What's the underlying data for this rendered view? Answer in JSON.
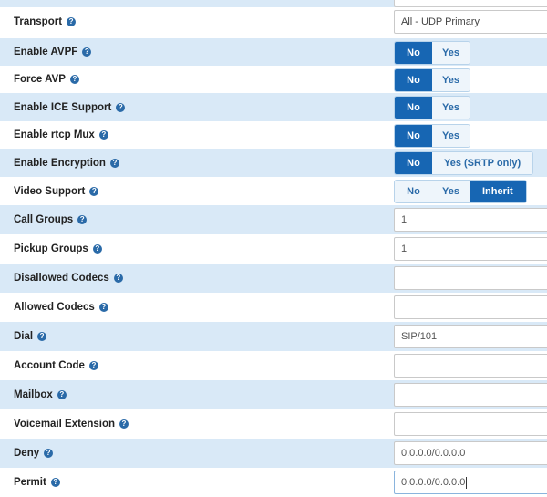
{
  "rows": [
    {
      "label": "Transport",
      "type": "select",
      "value": "All - UDP Primary"
    },
    {
      "label": "Enable AVPF",
      "type": "toggle",
      "options": [
        "No",
        "Yes"
      ],
      "selected": "No"
    },
    {
      "label": "Force AVP",
      "type": "toggle",
      "options": [
        "No",
        "Yes"
      ],
      "selected": "No"
    },
    {
      "label": "Enable ICE Support",
      "type": "toggle",
      "options": [
        "No",
        "Yes"
      ],
      "selected": "No"
    },
    {
      "label": "Enable rtcp Mux",
      "type": "toggle",
      "options": [
        "No",
        "Yes"
      ],
      "selected": "No"
    },
    {
      "label": "Enable Encryption",
      "type": "toggle",
      "options": [
        "No",
        "Yes (SRTP only)"
      ],
      "selected": "No"
    },
    {
      "label": "Video Support",
      "type": "toggle",
      "options": [
        "No",
        "Yes",
        "Inherit"
      ],
      "selected": "Inherit"
    },
    {
      "label": "Call Groups",
      "type": "text",
      "value": "1"
    },
    {
      "label": "Pickup Groups",
      "type": "text",
      "value": "1"
    },
    {
      "label": "Disallowed Codecs",
      "type": "text",
      "value": ""
    },
    {
      "label": "Allowed Codecs",
      "type": "text",
      "value": ""
    },
    {
      "label": "Dial",
      "type": "text",
      "value": "SIP/101"
    },
    {
      "label": "Account Code",
      "type": "text",
      "value": ""
    },
    {
      "label": "Mailbox",
      "type": "text",
      "value": ""
    },
    {
      "label": "Voicemail Extension",
      "type": "text",
      "value": ""
    },
    {
      "label": "Deny",
      "type": "text",
      "value": "0.0.0.0/0.0.0.0"
    },
    {
      "label": "Permit",
      "type": "text",
      "value": "0.0.0.0/0.0.0.0"
    }
  ],
  "help_icon_glyph": "?",
  "colors": {
    "row_shade": "#d9e9f7",
    "toggle_active": "#1766b3",
    "toggle_text": "#2a6aa8"
  }
}
